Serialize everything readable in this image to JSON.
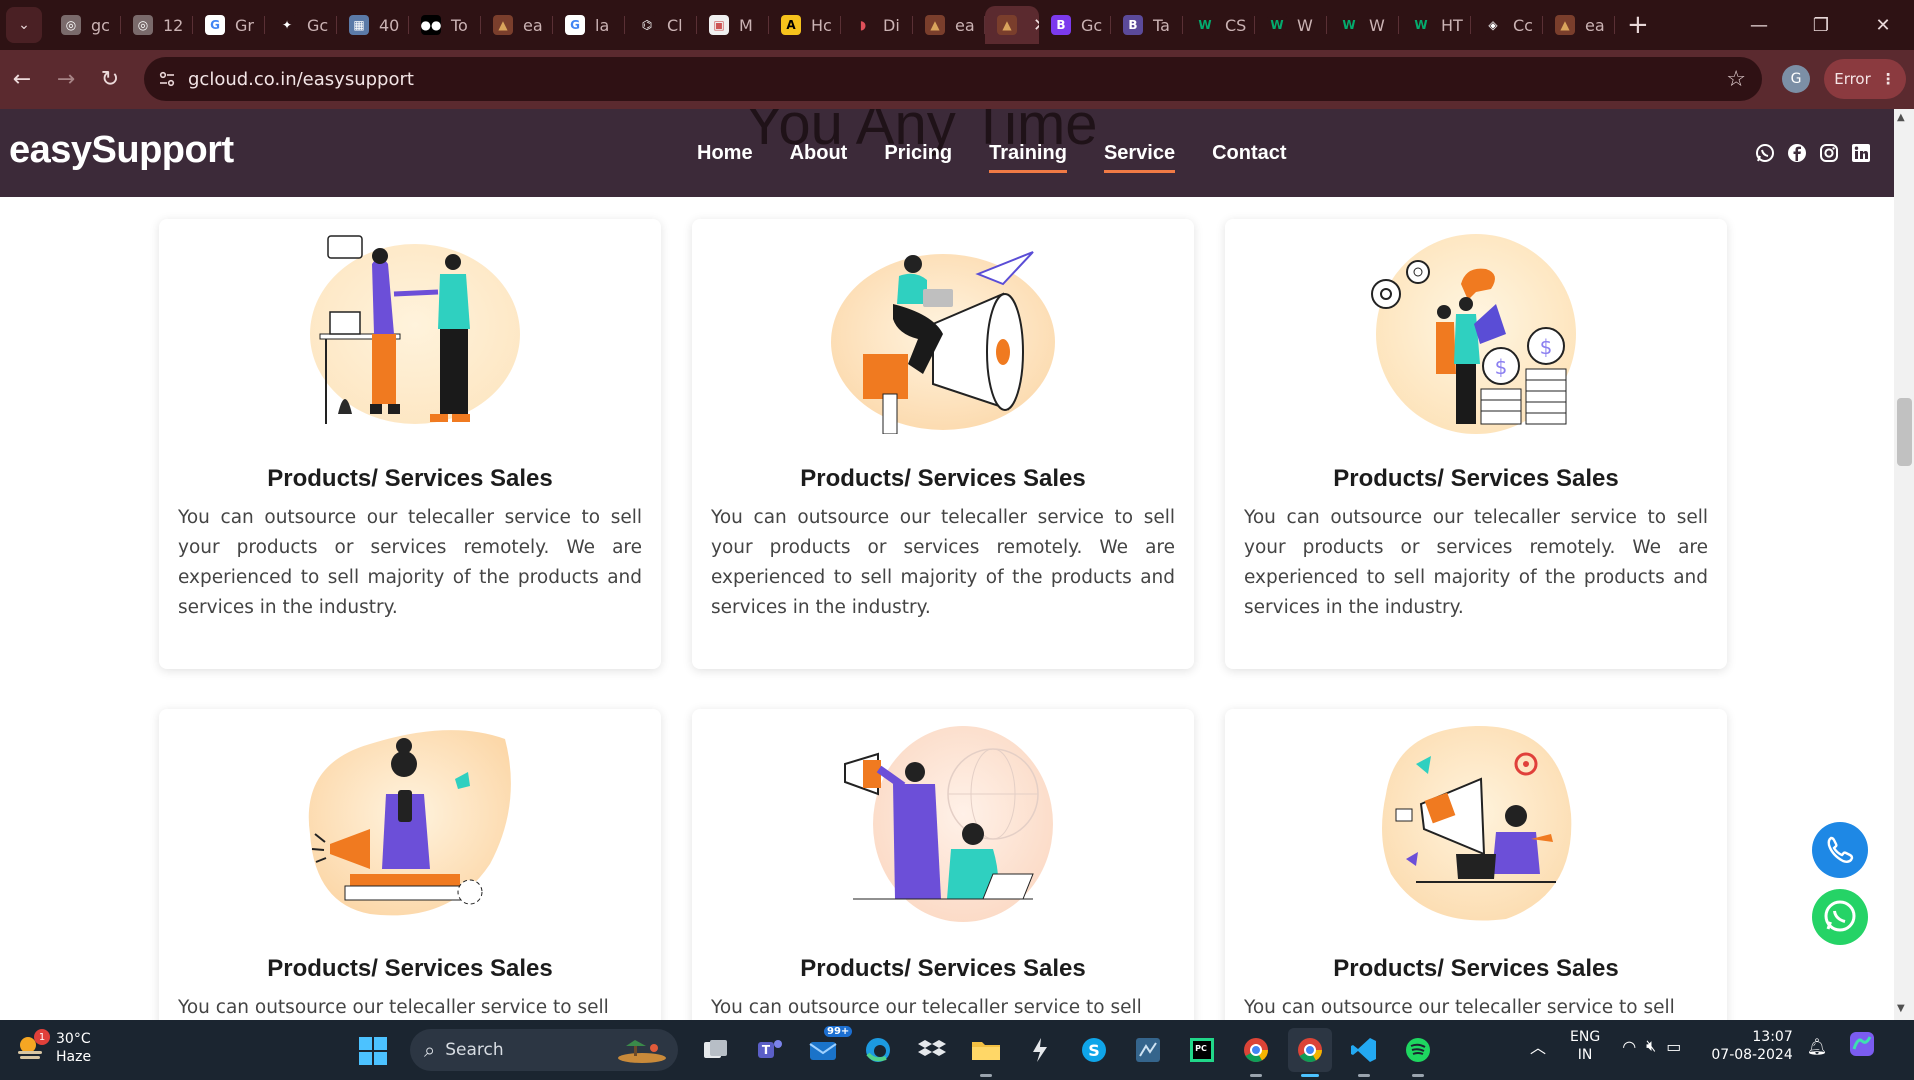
{
  "browser": {
    "tabs": [
      {
        "label": "gc",
        "icon": "globe-icon"
      },
      {
        "label": "12",
        "icon": "globe-icon"
      },
      {
        "label": "Gr",
        "icon": "google-icon"
      },
      {
        "label": "Gc",
        "icon": "gemini-icon"
      },
      {
        "label": "40",
        "icon": "calendar-icon"
      },
      {
        "label": "To",
        "icon": "medium-icon"
      },
      {
        "label": "ea",
        "icon": "site-favicon-icon"
      },
      {
        "label": "la",
        "icon": "google-icon"
      },
      {
        "label": "Cl",
        "icon": "openai-icon"
      },
      {
        "label": "M",
        "icon": "page-icon"
      },
      {
        "label": "Hc",
        "icon": "a-letter-icon"
      },
      {
        "label": "Di",
        "icon": "arc-icon"
      },
      {
        "label": "ea",
        "icon": "site-favicon-icon"
      },
      {
        "label": "",
        "icon": "site-favicon-icon",
        "active": true
      },
      {
        "label": "Gc",
        "icon": "bootstrap-icon"
      },
      {
        "label": "Ta",
        "icon": "bootstrap-dark-icon"
      },
      {
        "label": "CS",
        "icon": "w3schools-icon"
      },
      {
        "label": "W",
        "icon": "w3schools-icon"
      },
      {
        "label": "W",
        "icon": "w3schools-icon"
      },
      {
        "label": "HT",
        "icon": "w3schools-icon"
      },
      {
        "label": "Cc",
        "icon": "codepen-icon"
      },
      {
        "label": "ea",
        "icon": "site-favicon-icon"
      }
    ],
    "url": "gcloud.co.in/easysupport",
    "profile_initial": "G",
    "error_label": "Error"
  },
  "site": {
    "logo": "easySupport",
    "hero_ghost_text": "You Any Time",
    "nav": [
      {
        "label": "Home",
        "underlined": false
      },
      {
        "label": "About",
        "underlined": false
      },
      {
        "label": "Pricing",
        "underlined": false
      },
      {
        "label": "Training",
        "underlined": true
      },
      {
        "label": "Service",
        "underlined": true
      },
      {
        "label": "Contact",
        "underlined": false
      }
    ],
    "socials": [
      "whatsapp-icon",
      "facebook-icon",
      "instagram-icon",
      "linkedin-icon"
    ],
    "accent_color": "#f07a45",
    "header_color": "#3c2a39"
  },
  "cards": [
    {
      "title": "Products/ Services Sales",
      "text": "You can outsource our telecaller service to sell your products or services remotely. We are experienced to sell majority of the products and services in the industry.",
      "illustration": "handshake-illustration"
    },
    {
      "title": "Products/ Services Sales",
      "text": "You can outsource our telecaller service to sell your products or services remotely. We are experienced to sell majority of the products and services in the industry.",
      "illustration": "megaphone-illustration"
    },
    {
      "title": "Products/ Services Sales",
      "text": "You can outsource our telecaller service to sell your products or services remotely. We are experienced to sell majority of the products and services in the industry.",
      "illustration": "coins-illustration"
    },
    {
      "title": "Products/ Services Sales",
      "text": "You can outsource our telecaller service to sell",
      "illustration": "phone-promo-illustration"
    },
    {
      "title": "Products/ Services Sales",
      "text": "You can outsource our telecaller service to sell",
      "illustration": "announcer-illustration"
    },
    {
      "title": "Products/ Services Sales",
      "text": "You can outsource our telecaller service to sell",
      "illustration": "laptop-marketing-illustration"
    }
  ],
  "floating": {
    "call_color": "#1e88e5",
    "whatsapp_color": "#25d366"
  },
  "taskbar": {
    "weather_temp": "30°C",
    "weather_desc": "Haze",
    "weather_badge": "1",
    "search_label": "Search",
    "mail_badge": "99+",
    "lang_top": "ENG",
    "lang_bottom": "IN",
    "time": "13:07",
    "date": "07-08-2024"
  }
}
